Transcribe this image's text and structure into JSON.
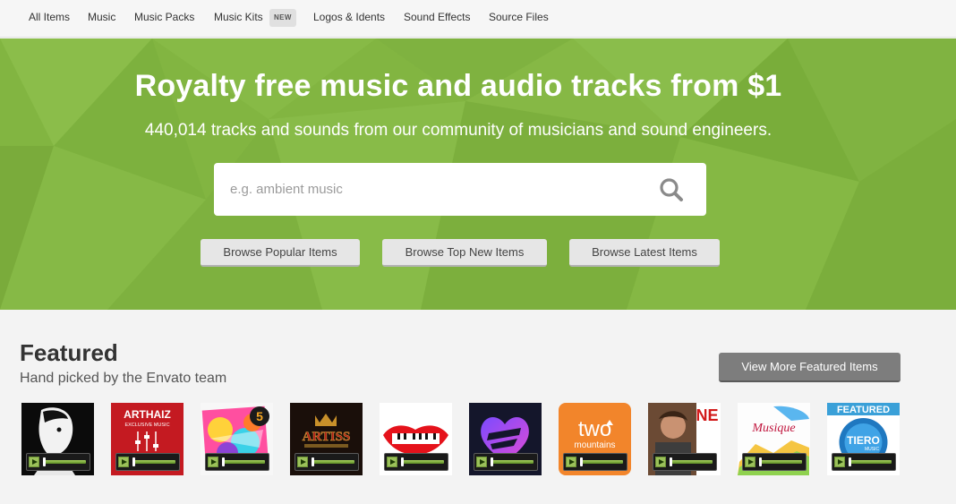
{
  "nav": {
    "items": [
      "All Items",
      "Music",
      "Music Packs",
      "Music Kits",
      "Logos & Idents",
      "Sound Effects",
      "Source Files"
    ],
    "new_badge": "NEW"
  },
  "hero": {
    "title": "Royalty free music and audio tracks from $1",
    "subtitle": "440,014 tracks and sounds from our community of musicians and sound engineers.",
    "search_placeholder": "e.g. ambient music",
    "search_icon": "search-icon",
    "buttons": [
      "Browse Popular Items",
      "Browse Top New Items",
      "Browse Latest Items"
    ],
    "background_color": "#82b541"
  },
  "featured": {
    "heading": "Featured",
    "tagline": "Hand picked by the Envato team",
    "view_more": "View More Featured Items",
    "thumbnails": [
      {
        "text": ""
      },
      {
        "text": "ARTHAIZ",
        "text2": "EXCLUSIVE MUSIC"
      },
      {
        "text": "5"
      },
      {
        "text": "ARTISS"
      },
      {
        "text": ""
      },
      {
        "text": ""
      },
      {
        "text": "two",
        "text2": "mountains"
      },
      {
        "text": "NE"
      },
      {
        "text": "Musique"
      },
      {
        "text": "FEATURED",
        "text2": "TIERO",
        "text3": "MUSIC"
      }
    ]
  },
  "colors": {
    "accent_green": "#82b541",
    "player_green": "#9bc15a",
    "button_gray": "#7d7d7d"
  }
}
